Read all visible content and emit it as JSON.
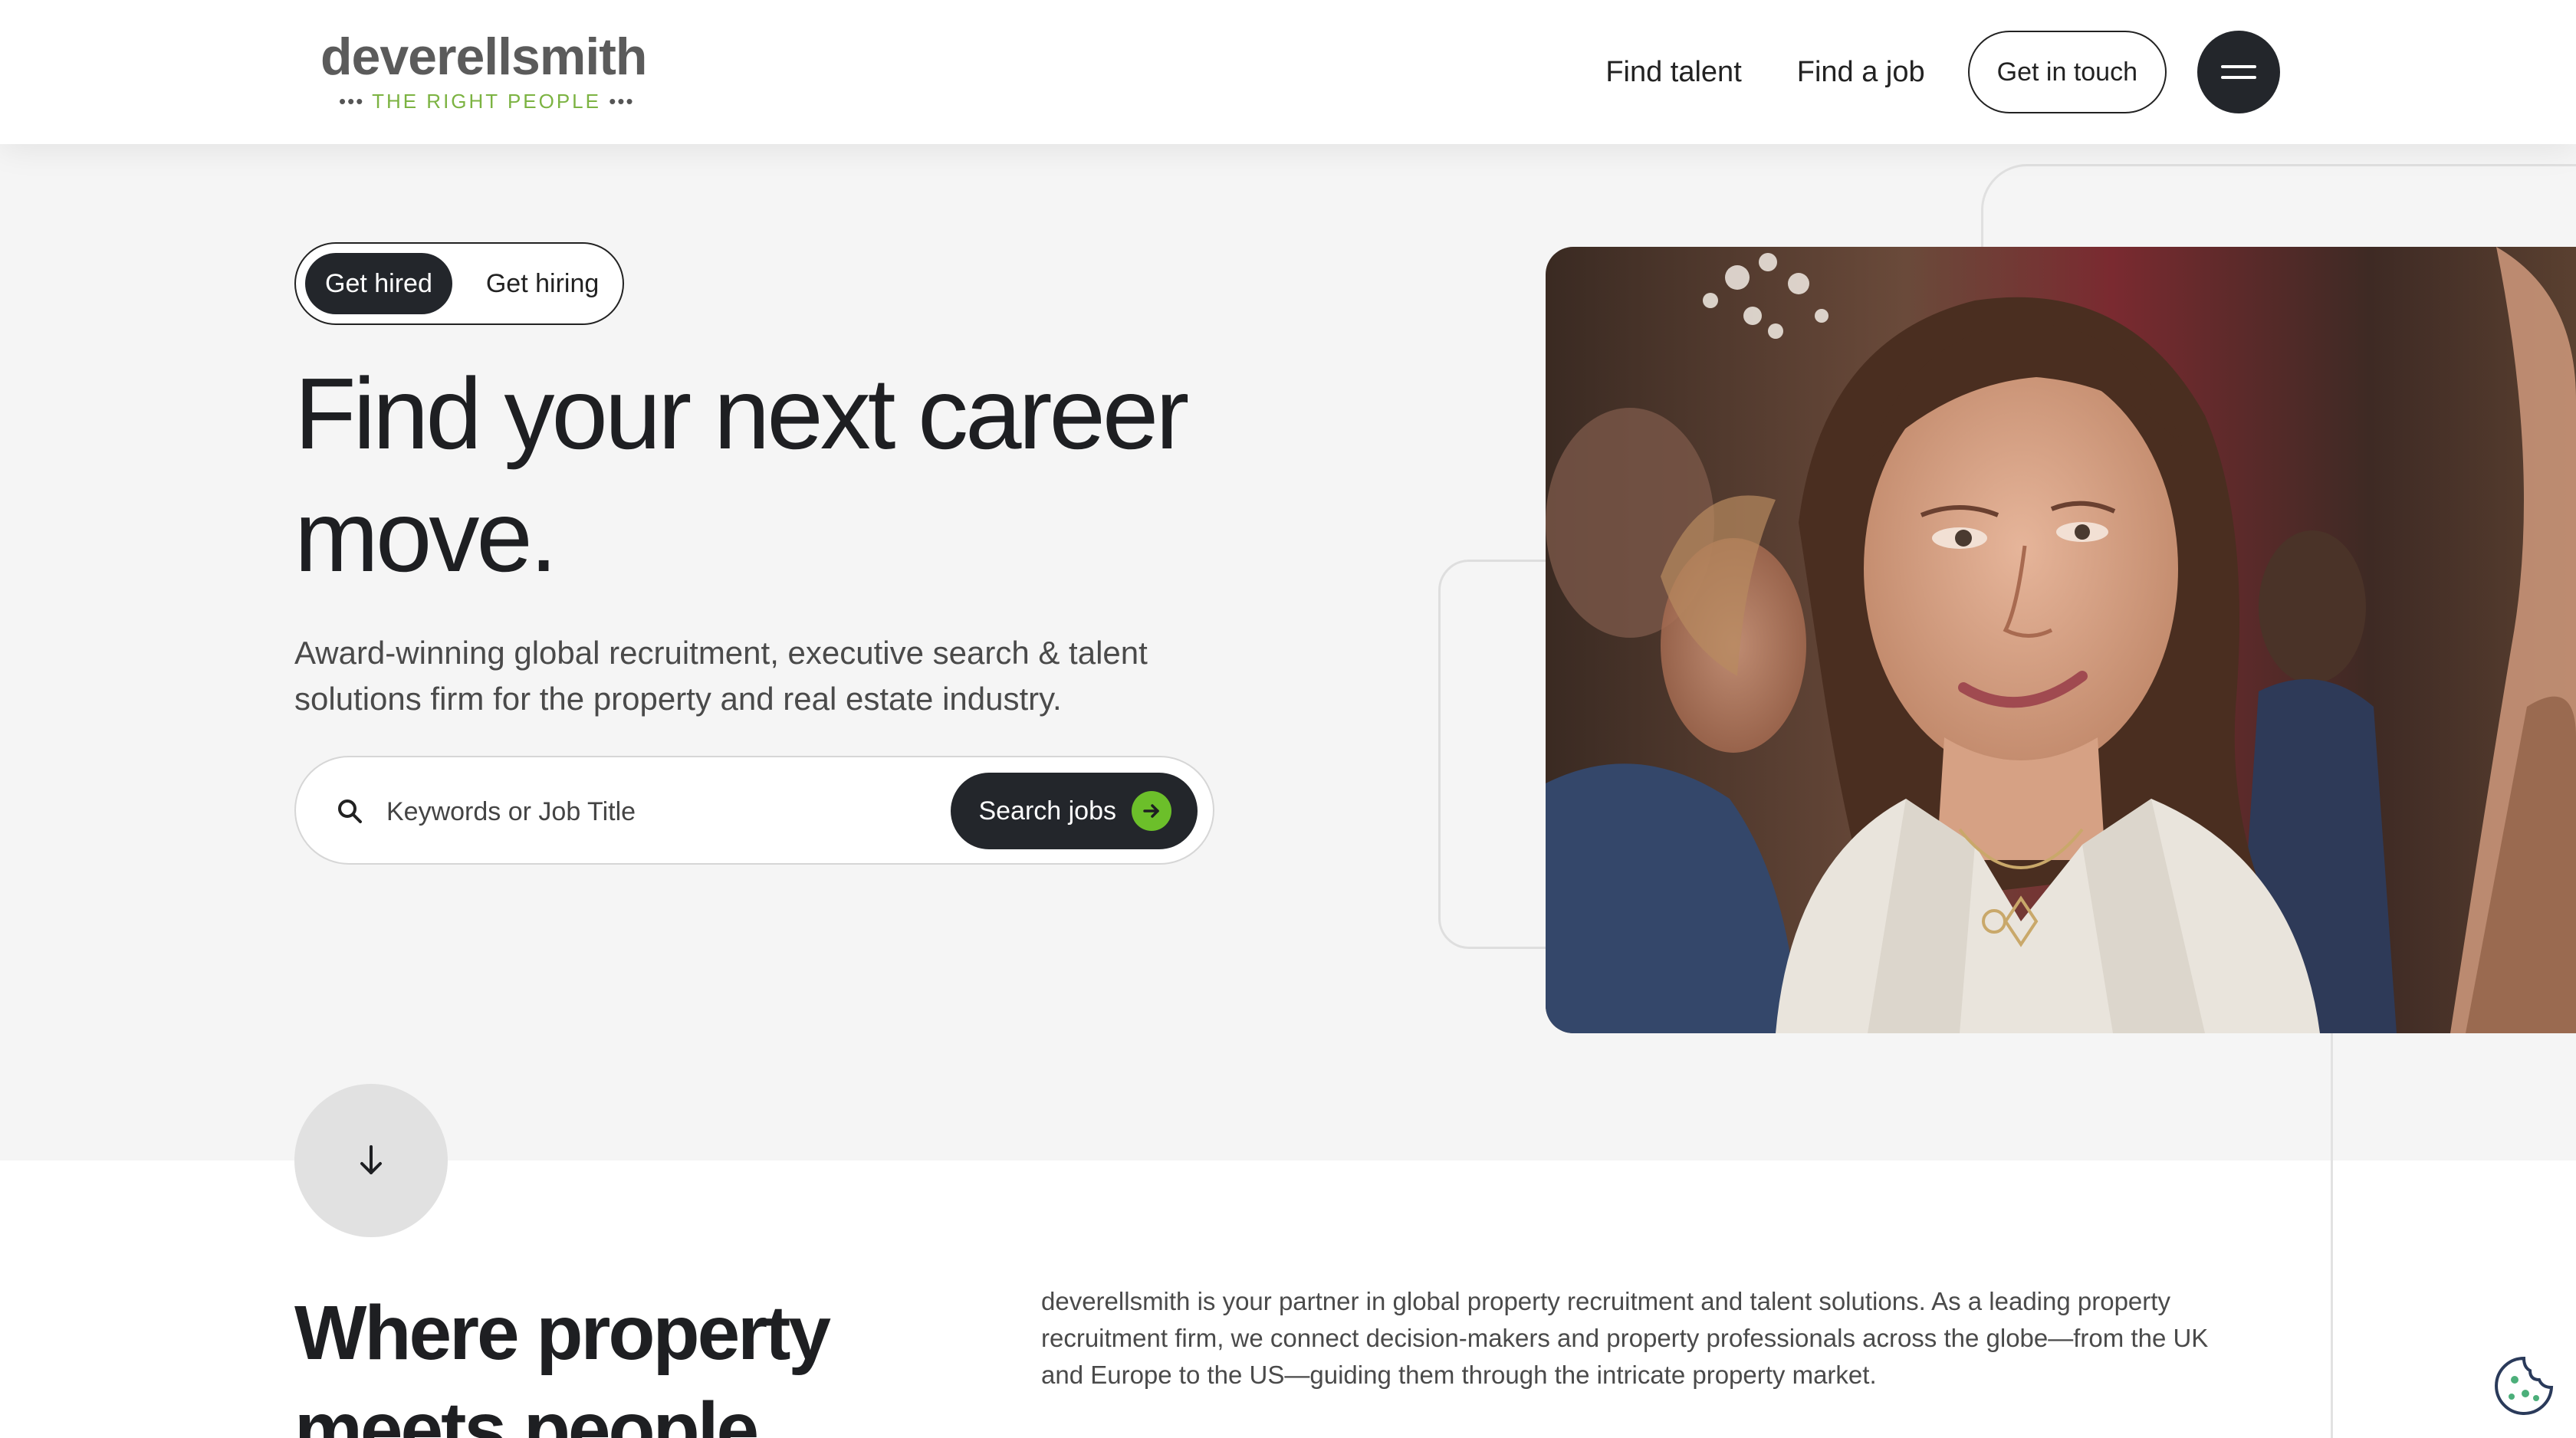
{
  "header": {
    "logo_word": "deverellsmith",
    "logo_tagline": "THE RIGHT PEOPLE",
    "nav": {
      "find_talent": "Find talent",
      "find_job": "Find a job"
    },
    "get_in_touch": "Get in touch"
  },
  "hero": {
    "toggle": {
      "active": "Get hired",
      "inactive": "Get hiring"
    },
    "title": "Find your next career move.",
    "subtitle": "Award-winning global recruitment, executive search & talent solutions firm for the property and real estate industry.",
    "search": {
      "placeholder": "Keywords or Job Title",
      "button": "Search jobs"
    }
  },
  "intro": {
    "title": "Where property meets people",
    "text": "deverellsmith is your partner in global property recruitment and talent solutions. As a leading property recruitment firm, we connect decision-makers and property professionals across the globe—from the UK and Europe to the US—guiding them through the intricate property market."
  },
  "colors": {
    "accent_green": "#6cbf2a",
    "dark": "#23262b",
    "hero_bg": "#f5f5f5"
  },
  "icons": {
    "search": "magnifier-icon",
    "arrow": "arrow-right-icon",
    "down": "arrow-down-icon",
    "menu": "hamburger-icon",
    "cookie": "cookie-icon"
  }
}
